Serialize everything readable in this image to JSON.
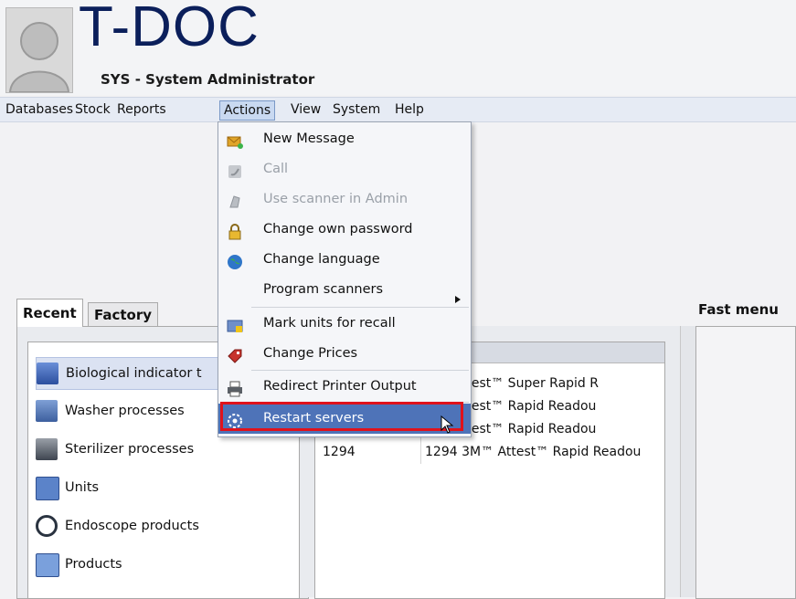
{
  "header": {
    "app_title": "T-DOC",
    "user": "SYS - System Administrator"
  },
  "menubar": {
    "items": [
      "Databases",
      "Stock",
      "Reports",
      "Actions",
      "View",
      "System",
      "Help"
    ],
    "active": "Actions"
  },
  "actions_menu": {
    "items": [
      {
        "label": "New Message",
        "icon": "new-message-icon",
        "enabled": true
      },
      {
        "label": "Call",
        "icon": "phone-icon",
        "enabled": false
      },
      {
        "label": "Use scanner in Admin",
        "icon": "scanner-icon",
        "enabled": false
      },
      {
        "label": "Change own password",
        "icon": "lock-icon",
        "enabled": true
      },
      {
        "label": "Change language",
        "icon": "globe-icon",
        "enabled": true
      },
      {
        "label": "Program scanners",
        "icon": "",
        "enabled": true,
        "submenu": true
      },
      {
        "label": "Mark units for recall",
        "icon": "recall-icon",
        "enabled": true
      },
      {
        "label": "Change Prices",
        "icon": "price-tag-icon",
        "enabled": true
      },
      {
        "label": "Redirect Printer Output",
        "icon": "printer-icon",
        "enabled": true
      },
      {
        "label": "Restart servers",
        "icon": "restart-icon",
        "enabled": true,
        "hovered": true
      }
    ]
  },
  "left_panel": {
    "tabs": [
      "Recent",
      "Factory"
    ],
    "active_tab": "Recent",
    "items": [
      {
        "label": "Biological indicator t",
        "icon": "biological-indicator-icon"
      },
      {
        "label": "Washer processes",
        "icon": "washer-icon"
      },
      {
        "label": "Sterilizer processes",
        "icon": "sterilizer-icon"
      },
      {
        "label": "Units",
        "icon": "units-icon"
      },
      {
        "label": "Endoscope products",
        "icon": "endoscope-icon"
      },
      {
        "label": "Products",
        "icon": "products-icon"
      }
    ]
  },
  "table": {
    "rows": [
      {
        "c1": "",
        "c2": "M™ Attest™ Super Rapid R"
      },
      {
        "c1": "",
        "c2": "M™ Attest™ Rapid Readou"
      },
      {
        "c1": "",
        "c2": "M™ Attest™ Rapid Readou"
      },
      {
        "c1": "1294",
        "c2": "1294 3M™ Attest™ Rapid Readou"
      }
    ]
  },
  "fast_menu": {
    "title": "Fast menu"
  },
  "colors": {
    "accent": "#4e73b8",
    "highlight_outline": "#e0121b",
    "logo": "#0b1f5b"
  }
}
